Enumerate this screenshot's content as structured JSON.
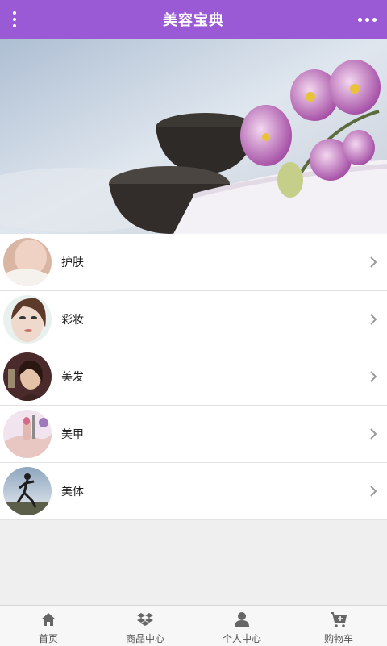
{
  "header": {
    "title": "美容宝典",
    "menu_icon": "vertical-dots-icon",
    "more_icon": "horizontal-dots-icon",
    "color": "#9a5ad6"
  },
  "banner": {
    "image": "orchid-spa-banner",
    "carousel_pages": 2,
    "active_page": 1
  },
  "categories": [
    {
      "label": "护肤",
      "icon": "skincare-thumb"
    },
    {
      "label": "彩妆",
      "icon": "makeup-thumb"
    },
    {
      "label": "美发",
      "icon": "hair-thumb"
    },
    {
      "label": "美甲",
      "icon": "nails-thumb"
    },
    {
      "label": "美体",
      "icon": "body-thumb"
    }
  ],
  "tabbar": {
    "tabs": [
      {
        "label": "首页",
        "icon": "home-icon"
      },
      {
        "label": "商品中心",
        "icon": "dropbox-icon"
      },
      {
        "label": "个人中心",
        "icon": "user-icon"
      },
      {
        "label": "购物车",
        "icon": "cart-icon"
      }
    ]
  }
}
